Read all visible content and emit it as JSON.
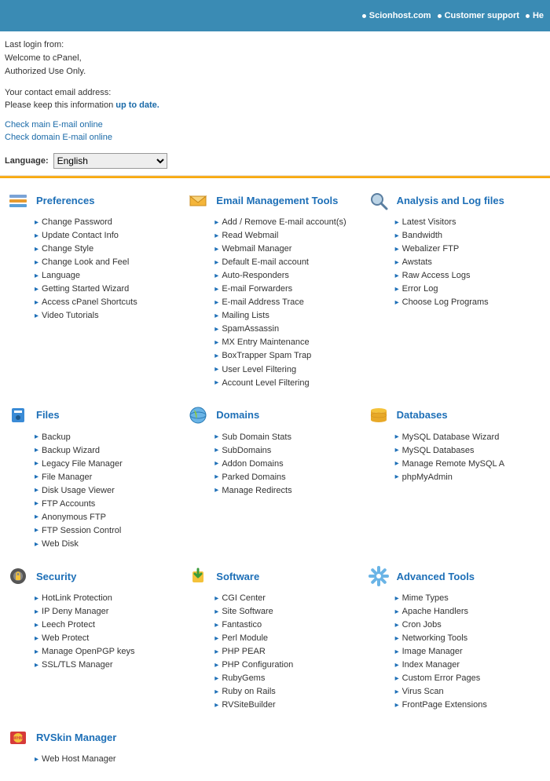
{
  "topnav": {
    "links": [
      "Scionhost.com",
      "Customer support",
      "He"
    ]
  },
  "info": {
    "lastlogin": "Last login from:",
    "welcome": "Welcome to cPanel,",
    "auth": "Authorized Use Only.",
    "contact": "Your contact email address:",
    "keep_prefix": "Please keep this information ",
    "keep_link": "up to date."
  },
  "checkmail": {
    "main": "Check main E-mail online",
    "domain": "Check domain E-mail online"
  },
  "language": {
    "label": "Language:",
    "value": "English"
  },
  "sections": [
    {
      "title": "Preferences",
      "icon": "preferences-icon",
      "items": [
        "Change Password",
        "Update Contact Info",
        "Change Style",
        "Change Look and Feel",
        "Language",
        "Getting Started Wizard",
        "Access cPanel Shortcuts",
        "Video Tutorials"
      ]
    },
    {
      "title": "Email Management Tools",
      "icon": "email-icon",
      "items": [
        "Add / Remove E-mail account(s)",
        "Read Webmail",
        "Webmail Manager",
        "Default E-mail account",
        "Auto-Responders",
        "E-mail Forwarders",
        "E-mail Address Trace",
        "Mailing Lists",
        "SpamAssassin",
        "MX Entry Maintenance",
        "BoxTrapper Spam Trap",
        "User Level Filtering",
        "Account Level Filtering"
      ]
    },
    {
      "title": "Analysis and Log files",
      "icon": "analysis-icon",
      "items": [
        "Latest Visitors",
        "Bandwidth",
        "Webalizer FTP",
        "Awstats",
        "Raw Access Logs",
        "Error Log",
        "Choose Log Programs"
      ]
    },
    {
      "title": "Files",
      "icon": "files-icon",
      "items": [
        "Backup",
        "Backup Wizard",
        "Legacy File Manager",
        "File Manager",
        "Disk Usage Viewer",
        "FTP Accounts",
        "Anonymous FTP",
        "FTP Session Control",
        "Web Disk"
      ]
    },
    {
      "title": "Domains",
      "icon": "domains-icon",
      "items": [
        "Sub Domain Stats",
        "SubDomains",
        "Addon Domains",
        "Parked Domains",
        "Manage Redirects"
      ]
    },
    {
      "title": "Databases",
      "icon": "databases-icon",
      "items": [
        "MySQL Database Wizard",
        "MySQL Databases",
        "Manage Remote MySQL A",
        "phpMyAdmin"
      ]
    },
    {
      "title": "Security",
      "icon": "security-icon",
      "items": [
        "HotLink Protection",
        "IP Deny Manager",
        "Leech Protect",
        "Web Protect",
        "Manage OpenPGP keys",
        "SSL/TLS Manager"
      ]
    },
    {
      "title": "Software",
      "icon": "software-icon",
      "items": [
        "CGI Center",
        "Site Software",
        "Fantastico",
        "Perl Module",
        "PHP PEAR",
        "PHP Configuration",
        "RubyGems",
        "Ruby on Rails",
        "RVSiteBuilder"
      ]
    },
    {
      "title": "Advanced Tools",
      "icon": "advanced-icon",
      "items": [
        "Mime Types",
        "Apache Handlers",
        "Cron Jobs",
        "Networking Tools",
        "Image Manager",
        "Index Manager",
        "Custom Error Pages",
        "Virus Scan",
        "FrontPage Extensions"
      ]
    },
    {
      "title": "RVSkin Manager",
      "icon": "rvskin-icon",
      "items": [
        "Web Host Manager"
      ]
    }
  ]
}
